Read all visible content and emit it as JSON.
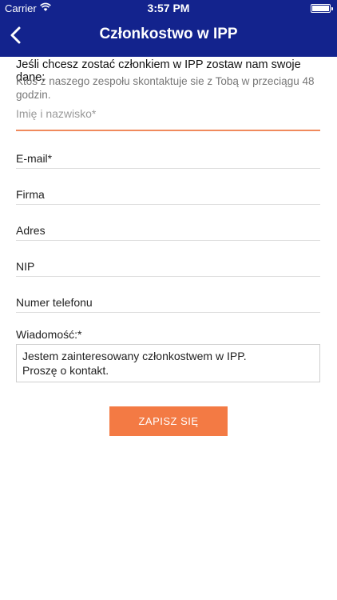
{
  "status_bar": {
    "carrier": "Carrier",
    "time": "3:57 PM"
  },
  "nav": {
    "title": "Członkostwo w IPP",
    "back_icon": "chevron-left-icon"
  },
  "intro": {
    "heading": "Jeśli chcesz zostać członkiem w IPP zostaw nam swoje dane:",
    "text": "Ktoś z naszego zespołu skontaktuje sie z Tobą w przeciągu 48 godzin."
  },
  "form": {
    "name_placeholder": "Imię i nazwisko*",
    "email_label": "E-mail*",
    "company_label": "Firma",
    "address_label": "Adres",
    "nip_label": "NIP",
    "phone_label": "Numer telefonu",
    "message_label": "Wiadomość:*",
    "message_value": "Jestem zainteresowany członkostwem w IPP.\nProszę o kontakt.",
    "submit_label": "ZAPISZ SIĘ"
  },
  "colors": {
    "header_bg": "#13238d",
    "accent": "#f37a44",
    "active_underline": "#f08a5d"
  }
}
